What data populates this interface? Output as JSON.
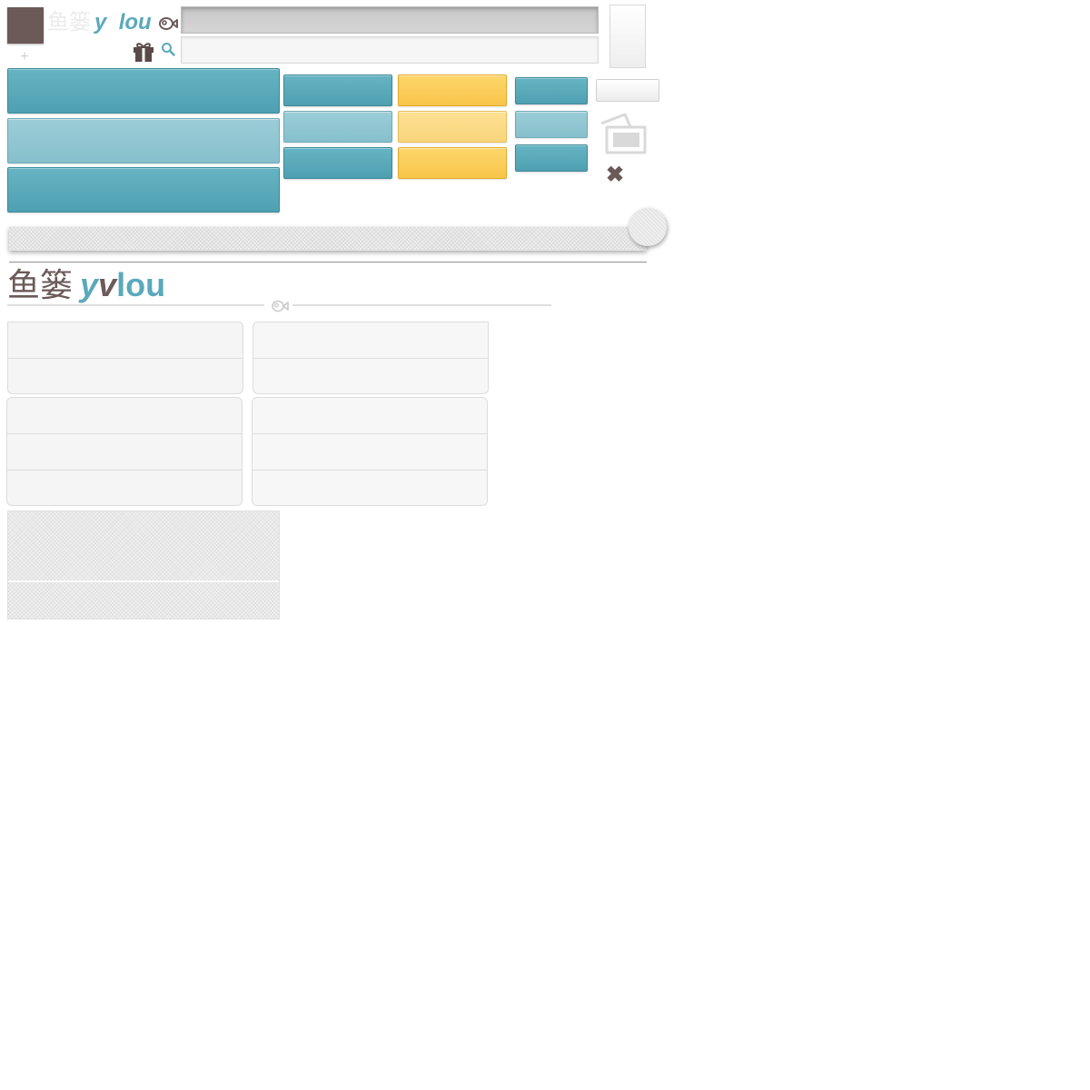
{
  "brand": {
    "chinese": "鱼篓",
    "latin_first": "y",
    "latin_middle": "v",
    "latin_rest": "lou",
    "primary_color": "#5aa9bb",
    "dark_color": "#6b5a58",
    "accent_color": "#f8c54a"
  },
  "icons": {
    "cross": "+",
    "close": "✖",
    "fish": "fish-logo-icon",
    "gift": "gift-icon",
    "search": "search-icon",
    "photo": "photo-frame-icon"
  },
  "inputs": {
    "dark_value": "",
    "light_value": ""
  }
}
